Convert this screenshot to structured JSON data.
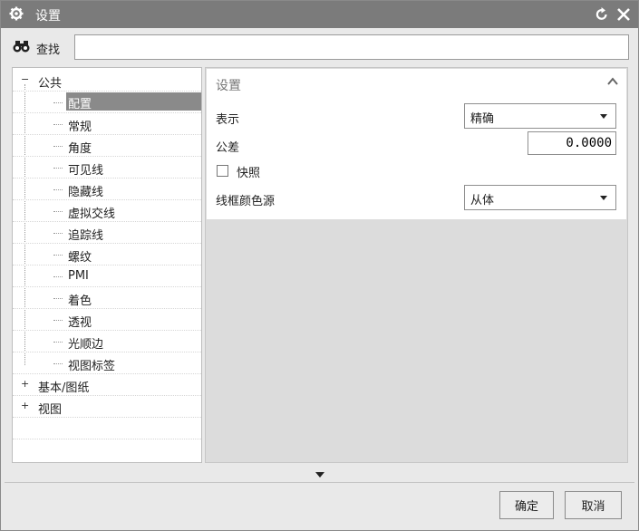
{
  "window": {
    "title": "设置"
  },
  "search": {
    "label": "查找",
    "value": "",
    "placeholder": ""
  },
  "tree": {
    "root": {
      "label": "公共",
      "expanded": true
    },
    "children": [
      {
        "label": "配置",
        "selected": true
      },
      {
        "label": "常规"
      },
      {
        "label": "角度"
      },
      {
        "label": "可见线"
      },
      {
        "label": "隐藏线"
      },
      {
        "label": "虚拟交线"
      },
      {
        "label": "追踪线"
      },
      {
        "label": "螺纹"
      },
      {
        "label": "PMI"
      },
      {
        "label": "着色"
      },
      {
        "label": "透视"
      },
      {
        "label": "光顺边"
      },
      {
        "label": "视图标签"
      }
    ],
    "collapsed_roots": [
      {
        "label": "基本/图纸"
      },
      {
        "label": "视图"
      }
    ]
  },
  "settings_group": {
    "title": "设置",
    "display": {
      "label": "表示",
      "value": "精确"
    },
    "tolerance": {
      "label": "公差",
      "value": "0.0000"
    },
    "snapshot": {
      "label": "快照",
      "checked": false
    },
    "wire_color_source": {
      "label": "线框颜色源",
      "value": "从体"
    }
  },
  "buttons": {
    "ok": "确定",
    "cancel": "取消"
  },
  "colors": {
    "titlebar": "#7b7b7b",
    "selection": "#8a8a8a",
    "panel_bg": "#dcdcdc"
  },
  "icons": [
    "gear-icon",
    "reset-icon",
    "close-icon",
    "binoculars-icon",
    "chevron-up-icon",
    "chevron-down-icon"
  ]
}
